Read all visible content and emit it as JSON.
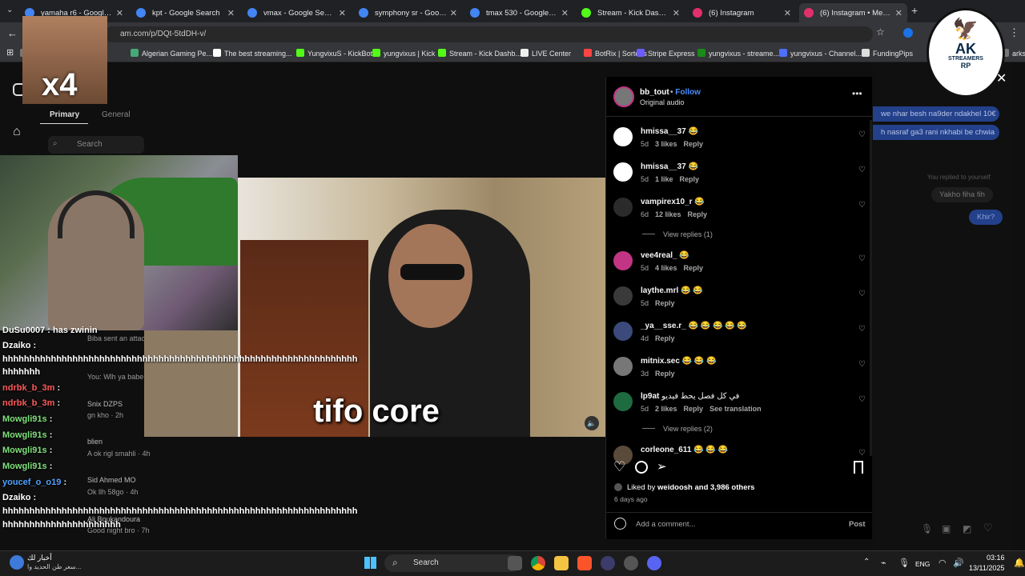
{
  "browser": {
    "tabs": [
      {
        "title": "yamaha r6 - Google Search",
        "color": "#4285f4"
      },
      {
        "title": "kpt - Google Search",
        "color": "#4285f4"
      },
      {
        "title": "vmax - Google Search",
        "color": "#4285f4"
      },
      {
        "title": "symphony sr - Google Search",
        "color": "#4285f4"
      },
      {
        "title": "tmax 530 - Google Search",
        "color": "#4285f4"
      },
      {
        "title": "Stream - Kick Dashboard",
        "color": "#53fc18"
      },
      {
        "title": "(6) Instagram",
        "color": "#e1306c"
      },
      {
        "title": "(6) Instagram • Messages",
        "color": "#e1306c",
        "active": true
      }
    ],
    "url": "am.com/p/DQt-5tdDH-v/",
    "bookmarks": [
      "ai...",
      "Algerian Gaming Pe...",
      "The best streaming...",
      "YungvixuS - KickBot",
      "yungvixus | Kick",
      "Stream - Kick Dashb...",
      "LIVE Center",
      "BotRix | Sorteos",
      "Stripe Express",
      "yungvixus - streame...",
      "yungvixus - Channel...",
      "FundingPips",
      "arks"
    ]
  },
  "dm_background": {
    "tabs": [
      "Primary",
      "General"
    ],
    "search_placeholder": "Search",
    "bubbles_right": [
      "we nhar besh na9der ndakhel 10€",
      "h nasraf ga3 rani nkhabi be chwia",
      "Yakho fiha fih",
      "Khir?"
    ],
    "replied_note": "You replied to yourself",
    "left_list": [
      {
        "name": "Biba sent an attach",
        "msg": ""
      },
      {
        "name": "",
        "msg": "You: Wlh ya babe ·"
      },
      {
        "name": "Snix DZPS",
        "msg": "gn kho · 2h"
      },
      {
        "name": "blien",
        "msg": "A ok rigl smahli · 4h"
      },
      {
        "name": "Sid Ahmed MO",
        "msg": "Ok llh 58go · 4h"
      },
      {
        "name": "Ali Boukandoura",
        "msg": "Good night bro · 7h"
      }
    ]
  },
  "stream": {
    "caption": "tifo core",
    "overlay_badge": "x4"
  },
  "chat": [
    {
      "user": "DuSu0007",
      "msg": ": has zwinin",
      "color": "#ffffff"
    },
    {
      "user": "Dzaiko",
      "msg": ":",
      "color": "#ffffff"
    },
    {
      "user": "",
      "msg": "hhhhhhhhhhhhhhhhhhhhhhhhhhhhhhhhhhhhhhhhhhhhhhhhhhhhhhhhhhhhhhhhhh",
      "color": "#ffffff"
    },
    {
      "user": "",
      "msg": "hhhhhhh",
      "color": "#ffffff"
    },
    {
      "user": "ndrbk_b_3m",
      "msg": ":",
      "color": "#ff5a5a"
    },
    {
      "user": "ndrbk_b_3m",
      "msg": ":",
      "color": "#ff5a5a"
    },
    {
      "user": "Mowgli91s",
      "msg": ":",
      "color": "#7ee07a"
    },
    {
      "user": "Mowgli91s",
      "msg": ":",
      "color": "#7ee07a"
    },
    {
      "user": "Mowgli91s",
      "msg": ":",
      "color": "#7ee07a"
    },
    {
      "user": "Mowgli91s",
      "msg": ":",
      "color": "#7ee07a"
    },
    {
      "user": "youcef_o_o19",
      "msg": ":",
      "color": "#4ea1ff"
    },
    {
      "user": "Dzaiko",
      "msg": ":",
      "color": "#ffffff"
    },
    {
      "user": "",
      "msg": "hhhhhhhhhhhhhhhhhhhhhhhhhhhhhhhhhhhhhhhhhhhhhhhhhhhhhhhhhhhhhhhhhh",
      "color": "#ffffff"
    },
    {
      "user": "",
      "msg": "hhhhhhhhhhhhhhhhhhhhhh",
      "color": "#ffffff"
    }
  ],
  "instagram": {
    "author": "bb_tout",
    "follow_label": "Follow",
    "audio": "Original audio",
    "comments": [
      {
        "user": "hmissa__37",
        "emoji": "😂",
        "time": "5d",
        "likes": "3 likes",
        "reply": "Reply",
        "avatar": "#ffffff"
      },
      {
        "user": "hmissa__37",
        "emoji": "😂",
        "time": "5d",
        "likes": "1 like",
        "reply": "Reply",
        "avatar": "#ffffff"
      },
      {
        "user": "vampirex10_r",
        "emoji": "😂",
        "time": "6d",
        "likes": "12 likes",
        "reply": "Reply",
        "avatar": "#2b2b2b",
        "view_replies": "View replies (1)"
      },
      {
        "user": "vee4real_",
        "emoji": "😂",
        "time": "5d",
        "likes": "4 likes",
        "reply": "Reply",
        "avatar": "#c13584"
      },
      {
        "user": "laythe.mrl",
        "emoji": "😂 😂",
        "time": "5d",
        "likes": "",
        "reply": "Reply",
        "avatar": "#3a3a3a"
      },
      {
        "user": "_ya__sse.r_",
        "emoji": "😂 😂 😂 😂 😂",
        "time": "4d",
        "likes": "",
        "reply": "Reply",
        "avatar": "#3b4a7a"
      },
      {
        "user": "mitnix.sec",
        "emoji": "😂 😂 😂",
        "time": "3d",
        "likes": "",
        "reply": "Reply",
        "avatar": "#777777"
      },
      {
        "user": "lp9at",
        "emoji": "في كل فصل يحط فيديو",
        "time": "5d",
        "likes": "2 likes",
        "reply": "Reply",
        "extra": "See translation",
        "avatar": "#1d6b3f",
        "view_replies": "View replies (2)"
      },
      {
        "user": "corleone_611",
        "emoji": "😂 😂 😂",
        "time": "",
        "likes": "",
        "reply": "",
        "avatar": "#5a4a3a"
      }
    ],
    "liked_by_prefix": "Liked by",
    "liked_by_user": "weidoosh",
    "liked_by_others": "and 3,986 others",
    "posted": "6 days ago",
    "comment_placeholder": "Add a comment...",
    "post_label": "Post"
  },
  "taskbar": {
    "news_title": "أخبار لك",
    "news_sub": "سعر طن الحديد وا...",
    "search_label": "Search",
    "lang": "ENG",
    "time": "03:16",
    "date": "13/11/2025"
  },
  "logo": {
    "top": "AK",
    "sub": "STREAMERS",
    "bottom": "RP"
  }
}
